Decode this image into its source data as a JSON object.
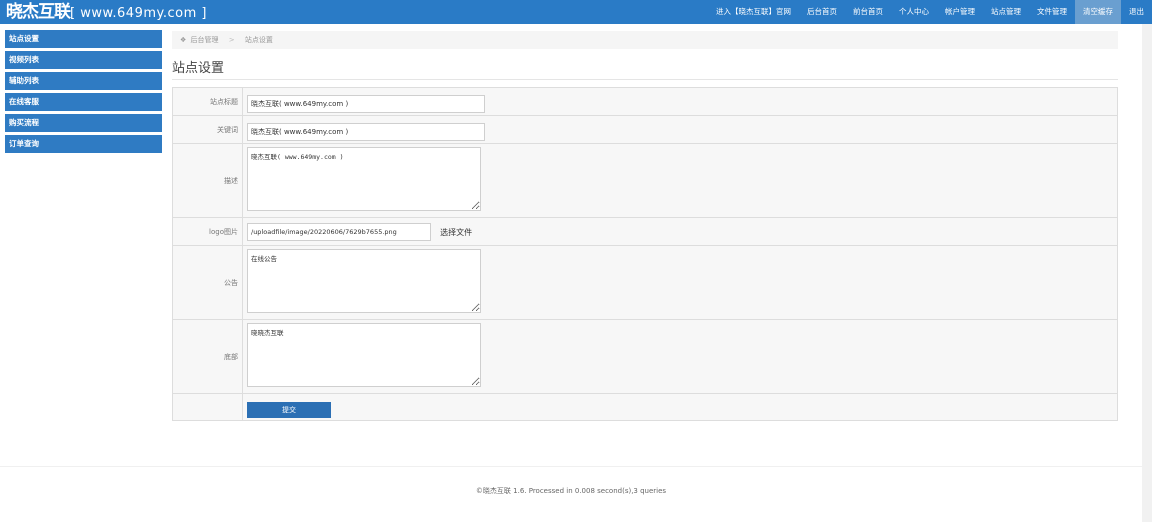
{
  "brand": {
    "name_cn": "晓杰互联",
    "name_en": "[ www.649my.com ]"
  },
  "nav": [
    {
      "label": "进入【晓杰互联】官网"
    },
    {
      "label": "后台首页"
    },
    {
      "label": "前台首页"
    },
    {
      "label": "个人中心"
    },
    {
      "label": "帐户管理"
    },
    {
      "label": "站点管理"
    },
    {
      "label": "文件管理"
    },
    {
      "label": "清空缓存",
      "active": true
    },
    {
      "label": "退出"
    }
  ],
  "sidebar": [
    {
      "label": "站点设置"
    },
    {
      "label": "视频列表"
    },
    {
      "label": "辅助列表"
    },
    {
      "label": "在线客服"
    },
    {
      "label": "购买流程"
    },
    {
      "label": "订单查询"
    }
  ],
  "breadcrumb": {
    "root": "后台管理",
    "separator": ">",
    "current": "站点设置"
  },
  "page_title": "站点设置",
  "form": {
    "site_title": {
      "label": "站点标题",
      "value": "晓杰互联( www.649my.com )"
    },
    "keywords": {
      "label": "关键词",
      "value": "晓杰互联( www.649my.com )"
    },
    "description": {
      "label": "描述",
      "value": "晓杰互联( www.649my.com )"
    },
    "logo": {
      "label": "logo图片",
      "value": "/uploadfile/image/20220606/7629b7655.png",
      "button": "选择文件"
    },
    "notice": {
      "label": "公告",
      "value": "在线公告"
    },
    "footer_text": {
      "label": "底部",
      "value": "晓晓杰互联"
    },
    "submit": "提交"
  },
  "footer": "©晓杰互联 1.6. Processed in 0.008 second(s),3 queries",
  "colors": {
    "primary": "#2a7bc6",
    "sidebar": "#2f7bc3",
    "button": "#2b6fb4",
    "active_nav": "#6a9fd0"
  }
}
